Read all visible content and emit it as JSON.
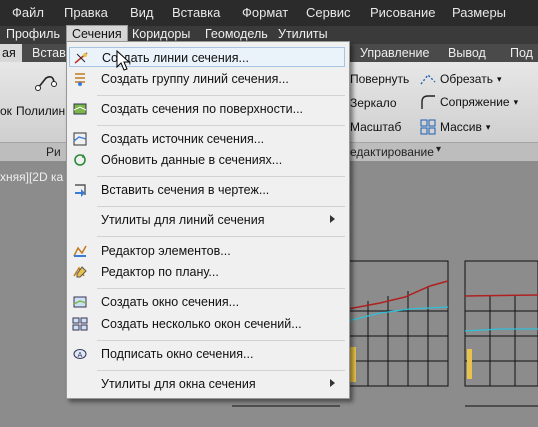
{
  "menubar": {
    "items": [
      "Файл",
      "Правка",
      "Вид",
      "Вставка",
      "Формат",
      "Сервис",
      "Рисование",
      "Размеры"
    ]
  },
  "menubar2": {
    "items": [
      "Профиль",
      "Сечения",
      "Коридоры",
      "Геомодель",
      "Утилиты"
    ]
  },
  "ribbon_tabs": {
    "first": "ая",
    "items": [
      "Встав",
      "Управление",
      "Вывод",
      "Под"
    ]
  },
  "ribbon": {
    "left_labels": [
      "ок",
      "Полилин"
    ],
    "group_label_left": "Ри",
    "tools": {
      "rotate": "Повернуть",
      "trim": "Обрезать",
      "mirror": "Зеркало",
      "fillet": "Сопряжение",
      "scale": "Масштаб",
      "array": "Массив"
    },
    "group_label_modify": "едактирование"
  },
  "viewport": {
    "label": "хняя][2D ка"
  },
  "dropdown": {
    "items": [
      {
        "label": "Создать линии сечения...",
        "icon": "create-sample-lines-icon",
        "highlighted": true
      },
      {
        "label": "Создать группу линий сечения...",
        "icon": "sample-line-group-icon"
      },
      {
        "label": "Создать сечения по поверхности...",
        "icon": "surface-sections-icon"
      },
      {
        "label": "Создать источник сечения...",
        "icon": "section-source-icon"
      },
      {
        "label": "Обновить данные в сечениях...",
        "icon": "update-sections-icon"
      },
      {
        "label": "Вставить сечения в чертеж...",
        "icon": "insert-sections-icon"
      },
      {
        "label": "Утилиты для линий сечения",
        "icon": "",
        "submenu": true
      },
      {
        "label": "Редактор элементов...",
        "icon": "element-editor-icon"
      },
      {
        "label": "Редактор по плану...",
        "icon": "plan-editor-icon"
      },
      {
        "label": "Создать окно сечения...",
        "icon": "create-section-view-icon"
      },
      {
        "label": "Создать несколько окон сечений...",
        "icon": "multiple-section-views-icon"
      },
      {
        "label": "Подписать окно сечения...",
        "icon": "label-section-view-icon"
      },
      {
        "label": "Утилиты для окна сечения",
        "icon": "",
        "submenu": true
      }
    ]
  }
}
